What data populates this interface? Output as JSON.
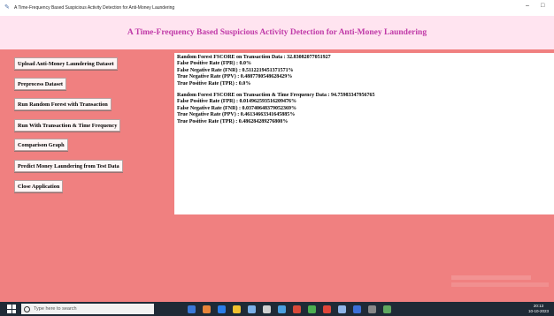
{
  "window": {
    "title": "A Time-Frequency Based Suspicious Activity Detection for Anti-Money Laundering",
    "minimize": "–",
    "restore": "□"
  },
  "banner": {
    "heading": "A Time-Frequency Based Suspicious Activity Detection for Anti-Money Laundering"
  },
  "buttons": [
    "Upload Anti-Money Laundering Dataset",
    "Preprocess Dataset",
    "Run Random Forest with Transaction",
    "Run With Transaction & Time Frequency",
    "Comparison Graph",
    "Predict Money Laundering from Test Data",
    "Close Application"
  ],
  "output": {
    "block1": [
      "Random Forest FSCORE on Transaction Data : 32.83082077051927",
      "False Positive Rate (FPR) : 0.0%",
      "False Negative Rate (FNR) : 0.5112219451371571%",
      "True Negative Rate (PPV) : 0.4887780548628429%",
      "True Positive Rate (TPR) : 0.0%"
    ],
    "block2": [
      "Random Forest FSCORE on Transaction & Time Frequency Data : 94.75983347956765",
      "False Positive Rate (FPR) : 0.014962593516209476%",
      "False Negative Rate (FNR) : 0.03740648379052369%",
      "True Negative Rate (PPV) : 0.46134663341645885%",
      "True Positive Rate (TPR) : 0.486284289276808%"
    ]
  },
  "taskbar": {
    "search_placeholder": "Type here to search",
    "time": "20:13",
    "date": "10-10-2023"
  },
  "colors": {
    "window_bg": "#f08080",
    "banner_bg": "#ffe4f0",
    "banner_text": "#c03aa8",
    "taskbar_bg": "#1f2a36"
  }
}
